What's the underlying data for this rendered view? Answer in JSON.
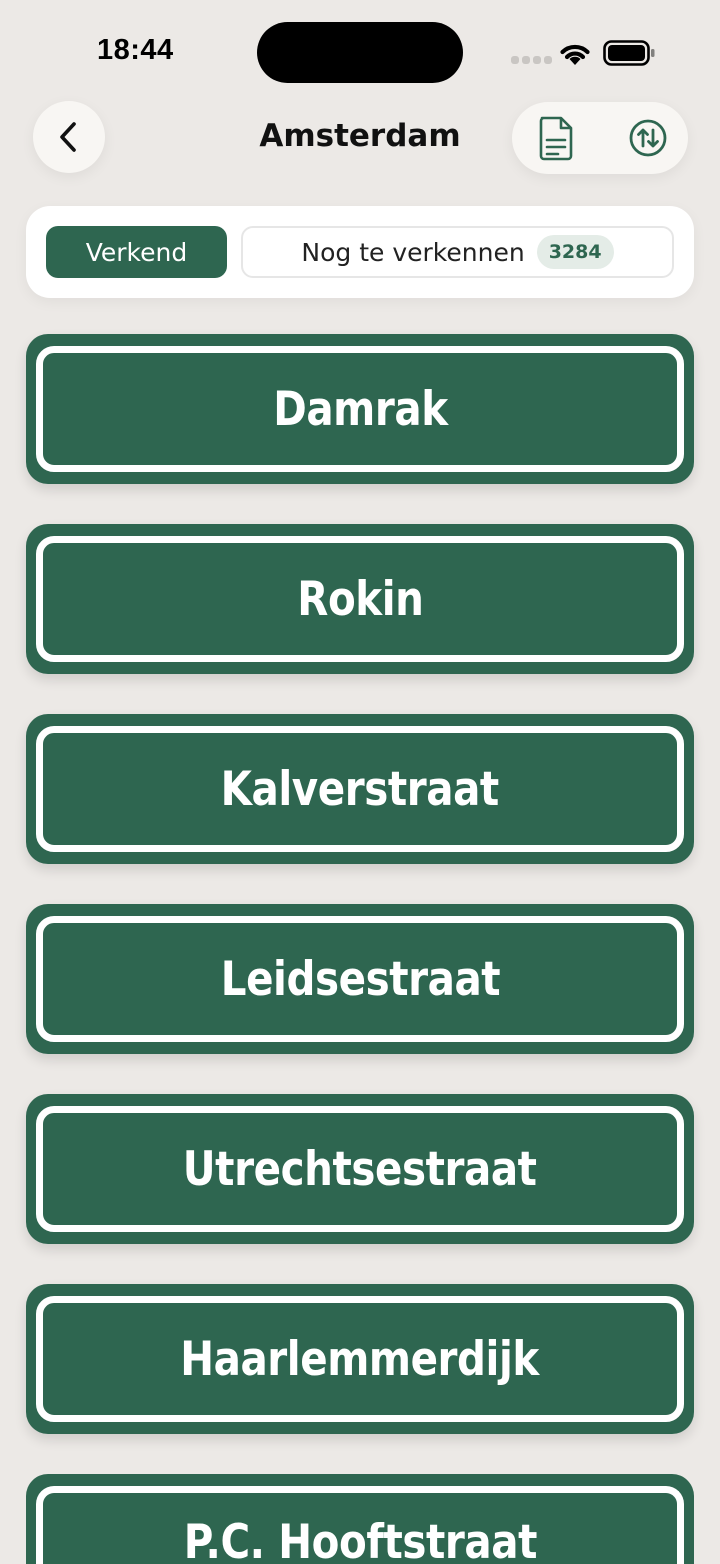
{
  "status_bar": {
    "time": "18:44"
  },
  "header": {
    "title": "Amsterdam",
    "icons": {
      "back": "chevron-left-icon",
      "document": "document-icon",
      "sort": "sort-arrows-icon"
    }
  },
  "segments": {
    "active_label": "Verkend",
    "inactive_label": "Nog te verkennen",
    "inactive_count": "3284"
  },
  "streets": [
    "Damrak",
    "Rokin",
    "Kalverstraat",
    "Leidsestraat",
    "Utrechtsestraat",
    "Haarlemmerdijk",
    "P.C. Hooftstraat"
  ],
  "colors": {
    "background": "#ECE9E6",
    "sign_green": "#2E6650",
    "sign_border": "#FFFFFF",
    "card": "#FFFFFF",
    "badge_bg": "#E4ECE7"
  }
}
